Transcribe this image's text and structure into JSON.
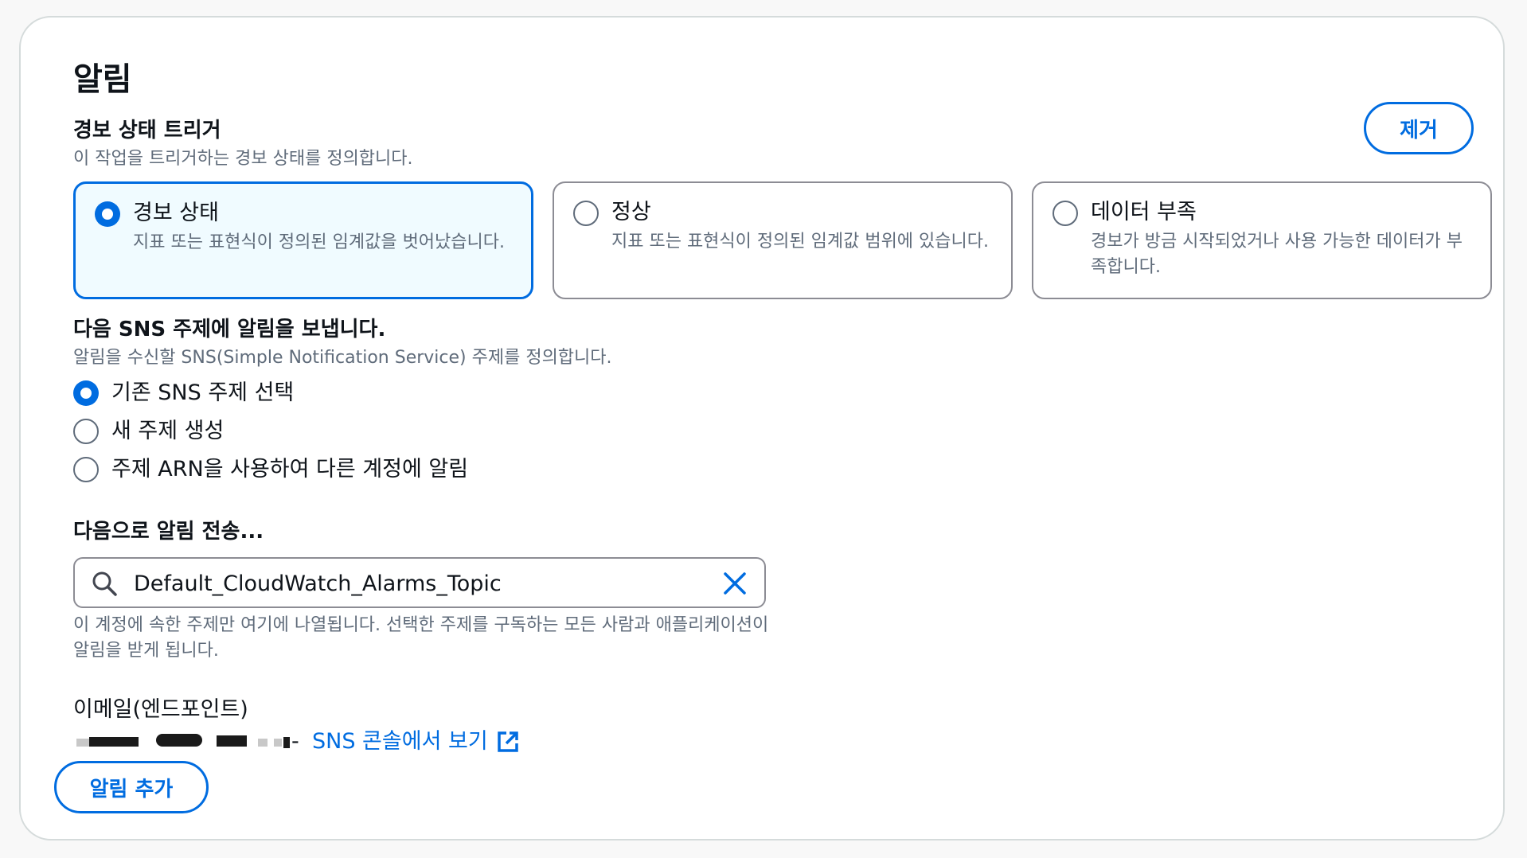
{
  "title": "알림",
  "trigger": {
    "heading": "경보 상태 트리거",
    "description": "이 작업을 트리거하는 경보 상태를 정의합니다.",
    "remove_label": "제거",
    "options": [
      {
        "label": "경보 상태",
        "description": "지표 또는 표현식이 정의된 임계값을 벗어났습니다.",
        "selected": true
      },
      {
        "label": "정상",
        "description": "지표 또는 표현식이 정의된 임계값 범위에 있습니다.",
        "selected": false
      },
      {
        "label": "데이터 부족",
        "description": "경보가 방금 시작되었거나 사용 가능한 데이터가 부족합니다.",
        "selected": false
      }
    ]
  },
  "sns": {
    "heading": "다음 SNS 주제에 알림을 보냅니다.",
    "description": "알림을 수신할 SNS(Simple Notification Service) 주제를 정의합니다.",
    "options": [
      {
        "label": "기존 SNS 주제 선택",
        "selected": true
      },
      {
        "label": "새 주제 생성",
        "selected": false
      },
      {
        "label": "주제 ARN을 사용하여 다른 계정에 알림",
        "selected": false
      }
    ]
  },
  "send_to": {
    "label": "다음으로 알림 전송...",
    "value": "Default_CloudWatch_Alarms_Topic",
    "hint": "이 계정에 속한 주제만 여기에 나열됩니다. 선택한 주제를 구독하는 모든 사람과 애플리케이션이 알림을 받게 됩니다."
  },
  "endpoint": {
    "label": "이메일(엔드포인트)",
    "separator": "-",
    "link_text": "SNS 콘솔에서 보기"
  },
  "add_notification_label": "알림 추가",
  "colors": {
    "accent": "#006ce0",
    "selected_bg": "#f0fbff",
    "muted_text": "#5f6b7a",
    "border": "#8c8c94"
  },
  "icons": [
    "search-icon",
    "clear-icon",
    "external-link-icon"
  ]
}
